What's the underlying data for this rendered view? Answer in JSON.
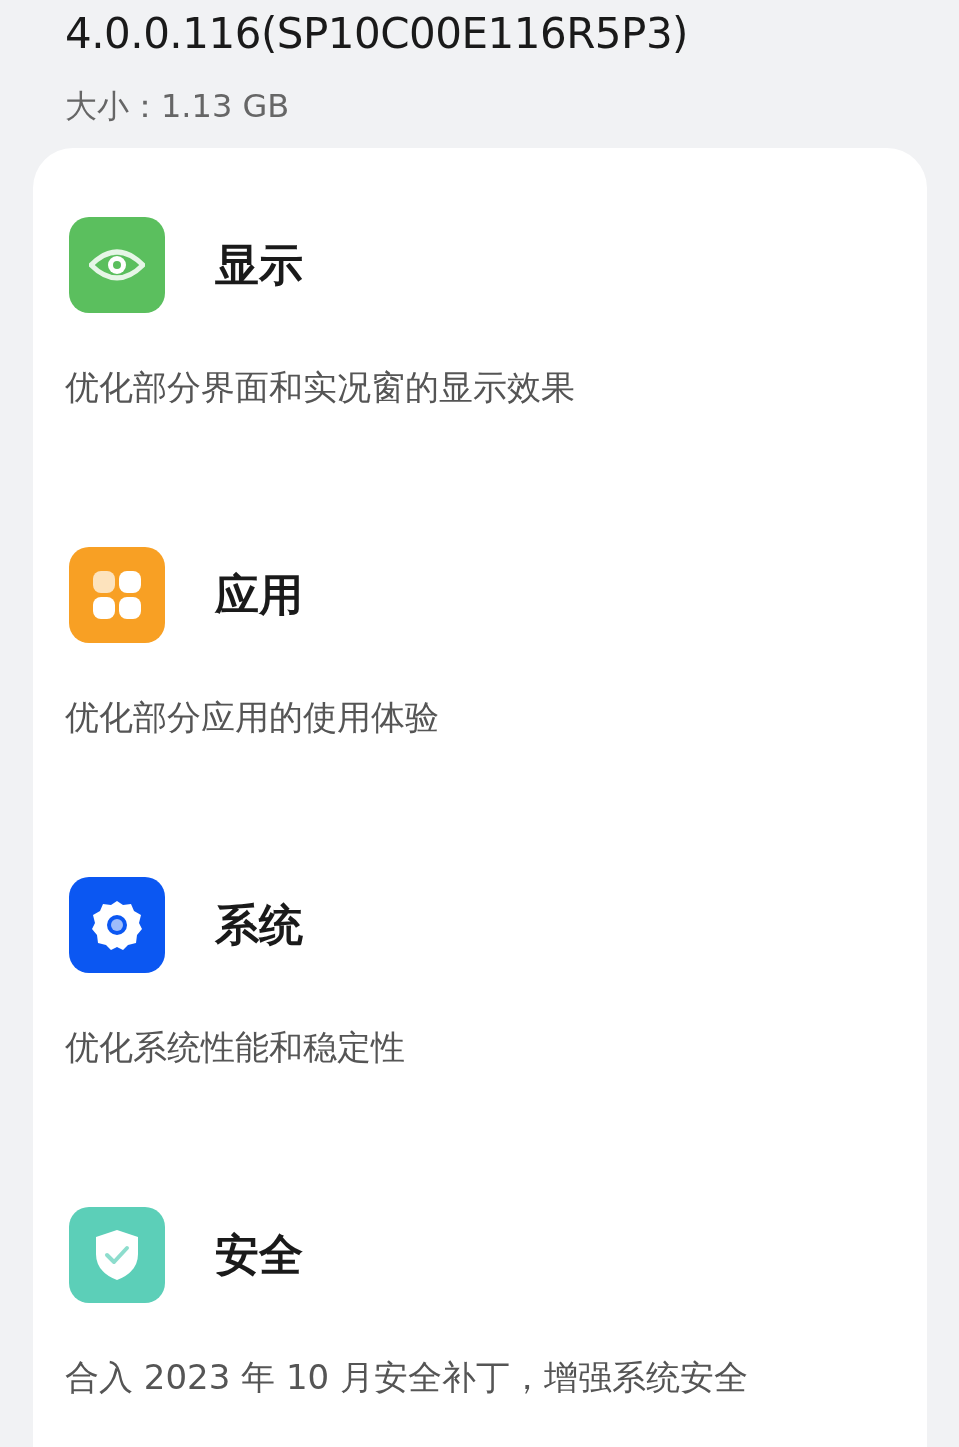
{
  "version": "4.0.0.116(SP10C00E116R5P3)",
  "size": "大小：1.13 GB",
  "items": [
    {
      "kind": "eye",
      "color": "#5bbf5e",
      "title": "显示",
      "description": "优化部分界面和实况窗的显示效果"
    },
    {
      "kind": "apps",
      "color": "#f8a024",
      "title": "应用",
      "description": "优化部分应用的使用体验"
    },
    {
      "kind": "gear",
      "color": "#0b57f2",
      "title": "系统",
      "description": "优化系统性能和稳定性"
    },
    {
      "kind": "shield",
      "color": "#5ccfb8",
      "title": "安全",
      "description": "合入 2023 年 10 月安全补丁，增强系统安全"
    }
  ]
}
